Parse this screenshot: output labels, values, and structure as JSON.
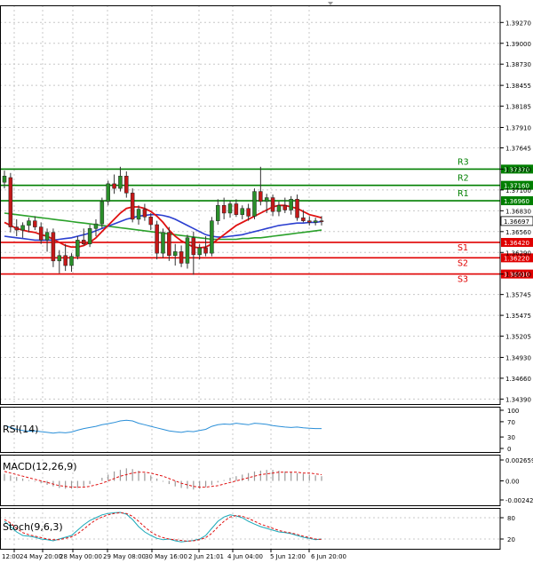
{
  "chart_data": [
    {
      "type": "candlestick",
      "title": "",
      "y_ticks": [
        "1.39270",
        "1.39000",
        "1.38730",
        "1.38455",
        "1.38185",
        "1.37910",
        "1.37645",
        "1.37370",
        "1.37100",
        "1.36830",
        "1.36560",
        "1.36290",
        "1.36010",
        "1.35745",
        "1.35475",
        "1.35205",
        "1.34930",
        "1.34660",
        "1.34390"
      ],
      "ylim": [
        1.3436,
        1.394
      ],
      "x_ticks": [
        "12:00",
        "24 May 20:00",
        "28 May 00:00",
        "29 May 08:00",
        "30 May 16:00",
        "2 Jun 21:01",
        "4 Jun 04:00",
        "5 Jun 12:00",
        "6 Jun 20:00"
      ],
      "current_price": {
        "label": "1.36697",
        "value": 1.36697
      },
      "levels": [
        {
          "name": "R3",
          "value": 1.3737,
          "label": "1.37370",
          "color": "#007f00"
        },
        {
          "name": "R2",
          "value": 1.3716,
          "label": "1.37160",
          "color": "#007f00"
        },
        {
          "name": "R1",
          "value": 1.3696,
          "label": "1.36960",
          "color": "#007f00"
        },
        {
          "name": "S1",
          "value": 1.3642,
          "label": "1.36420",
          "color": "#e00000"
        },
        {
          "name": "S2",
          "value": 1.3622,
          "label": "1.36220",
          "color": "#e00000"
        },
        {
          "name": "S3",
          "value": 1.3601,
          "label": "1.36010",
          "color": "#e00000"
        }
      ],
      "candles": [
        {
          "o": 1.372,
          "h": 1.3735,
          "l": 1.3712,
          "c": 1.3728
        },
        {
          "o": 1.3726,
          "h": 1.3732,
          "l": 1.3655,
          "c": 1.3662
        },
        {
          "o": 1.3662,
          "h": 1.3672,
          "l": 1.365,
          "c": 1.3658
        },
        {
          "o": 1.3658,
          "h": 1.3668,
          "l": 1.3648,
          "c": 1.3664
        },
        {
          "o": 1.3664,
          "h": 1.3674,
          "l": 1.3655,
          "c": 1.367
        },
        {
          "o": 1.367,
          "h": 1.3676,
          "l": 1.3658,
          "c": 1.3662
        },
        {
          "o": 1.3662,
          "h": 1.3668,
          "l": 1.364,
          "c": 1.3645
        },
        {
          "o": 1.3645,
          "h": 1.366,
          "l": 1.363,
          "c": 1.3655
        },
        {
          "o": 1.3655,
          "h": 1.366,
          "l": 1.361,
          "c": 1.3618
        },
        {
          "o": 1.3618,
          "h": 1.3632,
          "l": 1.3602,
          "c": 1.3625
        },
        {
          "o": 1.3625,
          "h": 1.364,
          "l": 1.3605,
          "c": 1.3612
        },
        {
          "o": 1.3612,
          "h": 1.3628,
          "l": 1.3604,
          "c": 1.3624
        },
        {
          "o": 1.3624,
          "h": 1.365,
          "l": 1.362,
          "c": 1.3645
        },
        {
          "o": 1.3645,
          "h": 1.366,
          "l": 1.3638,
          "c": 1.364
        },
        {
          "o": 1.364,
          "h": 1.3665,
          "l": 1.3636,
          "c": 1.366
        },
        {
          "o": 1.366,
          "h": 1.3672,
          "l": 1.365,
          "c": 1.3666
        },
        {
          "o": 1.3666,
          "h": 1.37,
          "l": 1.366,
          "c": 1.3695
        },
        {
          "o": 1.3695,
          "h": 1.3722,
          "l": 1.369,
          "c": 1.3718
        },
        {
          "o": 1.3718,
          "h": 1.373,
          "l": 1.3705,
          "c": 1.3712
        },
        {
          "o": 1.3712,
          "h": 1.374,
          "l": 1.3708,
          "c": 1.3728
        },
        {
          "o": 1.3728,
          "h": 1.3734,
          "l": 1.37,
          "c": 1.3706
        },
        {
          "o": 1.3706,
          "h": 1.3712,
          "l": 1.3668,
          "c": 1.3672
        },
        {
          "o": 1.3672,
          "h": 1.369,
          "l": 1.3665,
          "c": 1.3685
        },
        {
          "o": 1.3685,
          "h": 1.3692,
          "l": 1.367,
          "c": 1.3675
        },
        {
          "o": 1.3675,
          "h": 1.368,
          "l": 1.3658,
          "c": 1.3665
        },
        {
          "o": 1.3665,
          "h": 1.367,
          "l": 1.362,
          "c": 1.3628
        },
        {
          "o": 1.3628,
          "h": 1.366,
          "l": 1.3622,
          "c": 1.3655
        },
        {
          "o": 1.3655,
          "h": 1.3662,
          "l": 1.3618,
          "c": 1.3625
        },
        {
          "o": 1.3625,
          "h": 1.364,
          "l": 1.3612,
          "c": 1.363
        },
        {
          "o": 1.363,
          "h": 1.3638,
          "l": 1.361,
          "c": 1.3615
        },
        {
          "o": 1.3615,
          "h": 1.3652,
          "l": 1.3608,
          "c": 1.3648
        },
        {
          "o": 1.3648,
          "h": 1.3656,
          "l": 1.36,
          "c": 1.3626
        },
        {
          "o": 1.3626,
          "h": 1.364,
          "l": 1.362,
          "c": 1.3635
        },
        {
          "o": 1.3635,
          "h": 1.365,
          "l": 1.3624,
          "c": 1.3628
        },
        {
          "o": 1.3628,
          "h": 1.3675,
          "l": 1.3624,
          "c": 1.367
        },
        {
          "o": 1.367,
          "h": 1.3698,
          "l": 1.3665,
          "c": 1.369
        },
        {
          "o": 1.369,
          "h": 1.37,
          "l": 1.3672,
          "c": 1.368
        },
        {
          "o": 1.368,
          "h": 1.3696,
          "l": 1.3674,
          "c": 1.3692
        },
        {
          "o": 1.3692,
          "h": 1.3698,
          "l": 1.3675,
          "c": 1.3678
        },
        {
          "o": 1.3678,
          "h": 1.369,
          "l": 1.3672,
          "c": 1.3686
        },
        {
          "o": 1.3686,
          "h": 1.3692,
          "l": 1.367,
          "c": 1.3676
        },
        {
          "o": 1.3676,
          "h": 1.3712,
          "l": 1.3672,
          "c": 1.3708
        },
        {
          "o": 1.3708,
          "h": 1.374,
          "l": 1.369,
          "c": 1.3695
        },
        {
          "o": 1.3695,
          "h": 1.3705,
          "l": 1.368,
          "c": 1.37
        },
        {
          "o": 1.37,
          "h": 1.3704,
          "l": 1.3676,
          "c": 1.3682
        },
        {
          "o": 1.3682,
          "h": 1.3695,
          "l": 1.3676,
          "c": 1.369
        },
        {
          "o": 1.369,
          "h": 1.37,
          "l": 1.368,
          "c": 1.3684
        },
        {
          "o": 1.3684,
          "h": 1.3702,
          "l": 1.3678,
          "c": 1.3698
        },
        {
          "o": 1.3698,
          "h": 1.3704,
          "l": 1.367,
          "c": 1.3674
        },
        {
          "o": 1.3674,
          "h": 1.3684,
          "l": 1.3668,
          "c": 1.367
        },
        {
          "o": 1.367,
          "h": 1.3676,
          "l": 1.3664,
          "c": 1.3668
        },
        {
          "o": 1.3668,
          "h": 1.3674,
          "l": 1.3664,
          "c": 1.367
        },
        {
          "o": 1.367,
          "h": 1.3676,
          "l": 1.3664,
          "c": 1.3669
        }
      ],
      "ma_red": [
        1.3668,
        1.3664,
        1.366,
        1.3658,
        1.3656,
        1.3655,
        1.3652,
        1.365,
        1.3646,
        1.3642,
        1.3638,
        1.3636,
        1.3636,
        1.3638,
        1.3642,
        1.3648,
        1.3656,
        1.3664,
        1.3672,
        1.368,
        1.3686,
        1.3688,
        1.3688,
        1.3686,
        1.3682,
        1.3676,
        1.3668,
        1.3658,
        1.365,
        1.3644,
        1.364,
        1.3636,
        1.3635,
        1.3636,
        1.364,
        1.3646,
        1.3652,
        1.3658,
        1.3664,
        1.3668,
        1.3672,
        1.3676,
        1.368,
        1.3684,
        1.3688,
        1.369,
        1.369,
        1.3688,
        1.3686,
        1.3682,
        1.3678,
        1.3676,
        1.3674
      ],
      "ma_blue": [
        1.365,
        1.3649,
        1.3648,
        1.3647,
        1.3646,
        1.3645,
        1.3645,
        1.3645,
        1.3645,
        1.3646,
        1.3647,
        1.3648,
        1.365,
        1.3652,
        1.3654,
        1.3657,
        1.366,
        1.3663,
        1.3666,
        1.3669,
        1.3672,
        1.3674,
        1.3676,
        1.3677,
        1.3678,
        1.3678,
        1.3677,
        1.3675,
        1.3672,
        1.3668,
        1.3664,
        1.366,
        1.3656,
        1.3652,
        1.365,
        1.3649,
        1.3649,
        1.365,
        1.3651,
        1.3652,
        1.3654,
        1.3656,
        1.3658,
        1.366,
        1.3662,
        1.3664,
        1.3665,
        1.3666,
        1.3667,
        1.3667,
        1.3668,
        1.3668,
        1.3669
      ],
      "ma_green": [
        1.368,
        1.3679,
        1.3678,
        1.3677,
        1.3676,
        1.3675,
        1.3674,
        1.3673,
        1.3672,
        1.3671,
        1.367,
        1.3669,
        1.3668,
        1.3667,
        1.3666,
        1.3665,
        1.3664,
        1.3663,
        1.3662,
        1.3661,
        1.366,
        1.3659,
        1.3658,
        1.3657,
        1.3656,
        1.3655,
        1.3654,
        1.3653,
        1.3652,
        1.3651,
        1.365,
        1.3649,
        1.3648,
        1.3647,
        1.3646,
        1.3646,
        1.3646,
        1.3646,
        1.3646,
        1.3647,
        1.3647,
        1.3648,
        1.3648,
        1.3649,
        1.365,
        1.3651,
        1.3652,
        1.3653,
        1.3654,
        1.3655,
        1.3656,
        1.3657,
        1.3658
      ]
    },
    {
      "type": "line",
      "label": "RSI(14)",
      "y_ticks": [
        "100",
        "70",
        "30",
        "0"
      ],
      "ylim": [
        0,
        100
      ],
      "values": [
        60,
        55,
        50,
        47,
        45,
        46,
        44,
        42,
        40,
        42,
        41,
        43,
        48,
        52,
        55,
        58,
        62,
        65,
        68,
        72,
        74,
        72,
        66,
        62,
        58,
        54,
        50,
        46,
        44,
        42,
        45,
        44,
        47,
        50,
        58,
        62,
        64,
        63,
        66,
        64,
        62,
        66,
        65,
        63,
        60,
        58,
        56,
        55,
        56,
        54,
        53,
        52,
        52
      ]
    },
    {
      "type": "bar",
      "label": "MACD(12,26,9)",
      "y_ticks": [
        "0.002659",
        "0.00",
        "-0.002424"
      ],
      "ylim": [
        -0.002424,
        0.002659
      ],
      "histogram": [
        0.0009,
        0.0007,
        0.0005,
        0.0003,
        0.0001,
        -0.0001,
        -0.0003,
        -0.0005,
        -0.0007,
        -0.0009,
        -0.001,
        -0.001,
        -0.0009,
        -0.0007,
        -0.0004,
        0.0,
        0.0004,
        0.0008,
        0.0012,
        0.0014,
        0.0016,
        0.0015,
        0.0013,
        0.001,
        0.0007,
        0.0003,
        -0.0001,
        -0.0004,
        -0.0007,
        -0.0009,
        -0.001,
        -0.0011,
        -0.001,
        -0.0008,
        -0.0005,
        -0.0002,
        0.0001,
        0.0004,
        0.0006,
        0.0008,
        0.001,
        0.0012,
        0.0013,
        0.0014,
        0.0014,
        0.0013,
        0.0012,
        0.0011,
        0.001,
        0.0009,
        0.0008,
        0.0007,
        0.0006
      ],
      "signal": [
        0.0012,
        0.001,
        0.0008,
        0.0006,
        0.0004,
        0.0002,
        0.0,
        -0.0002,
        -0.0004,
        -0.0006,
        -0.0007,
        -0.0008,
        -0.0008,
        -0.0008,
        -0.0007,
        -0.0005,
        -0.0003,
        0.0,
        0.0003,
        0.0006,
        0.0008,
        0.001,
        0.0011,
        0.0011,
        0.001,
        0.0008,
        0.0006,
        0.0003,
        0.0,
        -0.0003,
        -0.0005,
        -0.0007,
        -0.0008,
        -0.0008,
        -0.0007,
        -0.0006,
        -0.0004,
        -0.0002,
        0.0,
        0.0002,
        0.0004,
        0.0006,
        0.0008,
        0.0009,
        0.001,
        0.0011,
        0.0011,
        0.0011,
        0.0011,
        0.001,
        0.001,
        0.0009,
        0.0008
      ]
    },
    {
      "type": "line",
      "label": "Stoch(9,6,3)",
      "y_ticks": [
        "80",
        "20"
      ],
      "ylim": [
        0,
        100
      ],
      "main": [
        70,
        55,
        40,
        30,
        28,
        25,
        20,
        18,
        15,
        20,
        25,
        30,
        45,
        60,
        72,
        80,
        88,
        92,
        94,
        95,
        90,
        75,
        55,
        40,
        30,
        22,
        18,
        20,
        15,
        12,
        14,
        16,
        20,
        30,
        50,
        70,
        82,
        88,
        85,
        80,
        70,
        62,
        55,
        50,
        45,
        40,
        38,
        35,
        30,
        25,
        22,
        18,
        20
      ],
      "signal": [
        75,
        65,
        50,
        38,
        32,
        28,
        24,
        20,
        18,
        18,
        22,
        26,
        35,
        48,
        62,
        74,
        82,
        88,
        92,
        94,
        92,
        84,
        70,
        54,
        40,
        30,
        24,
        20,
        18,
        16,
        14,
        15,
        18,
        24,
        36,
        54,
        70,
        82,
        86,
        84,
        78,
        70,
        62,
        56,
        50,
        44,
        40,
        37,
        33,
        28,
        24,
        20,
        19
      ]
    }
  ]
}
